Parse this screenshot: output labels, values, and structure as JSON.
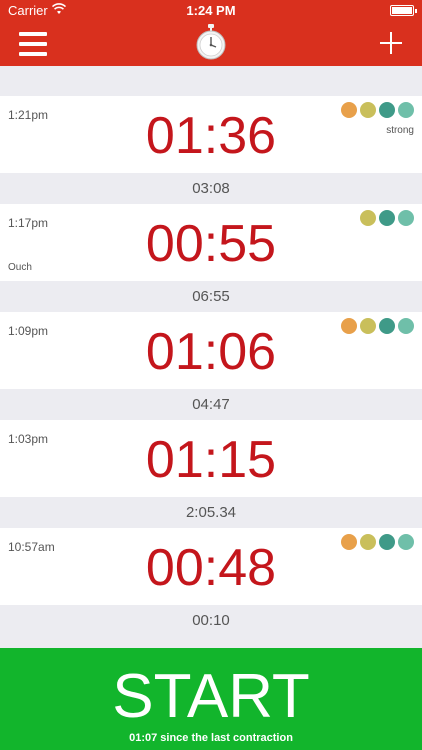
{
  "status_bar": {
    "carrier": "Carrier",
    "time": "1:24 PM"
  },
  "colors": {
    "accent": "#d9301e",
    "duration_text": "#c4161c",
    "start": "#12b52c",
    "dot_orange": "#e8a04a",
    "dot_olive": "#c9bf5b",
    "dot_teal": "#3f9a88",
    "dot_aqua": "#6fbfa9"
  },
  "navbar": {
    "menu_icon": "hamburger-menu-icon",
    "logo_icon": "stopwatch-icon",
    "add_icon": "plus-icon"
  },
  "contractions": [
    {
      "time": "1:21pm",
      "duration": "01:36",
      "note": "",
      "intensity": "strong",
      "dots": [
        "dot_orange",
        "dot_olive",
        "dot_teal",
        "dot_aqua"
      ]
    },
    {
      "interval": "03:08"
    },
    {
      "time": "1:17pm",
      "duration": "00:55",
      "note": "Ouch",
      "intensity": "",
      "dots": [
        "dot_olive",
        "dot_teal",
        "dot_aqua"
      ]
    },
    {
      "interval": "06:55"
    },
    {
      "time": "1:09pm",
      "duration": "01:06",
      "note": "",
      "intensity": "",
      "dots": [
        "dot_orange",
        "dot_olive",
        "dot_teal",
        "dot_aqua"
      ]
    },
    {
      "interval": "04:47"
    },
    {
      "time": "1:03pm",
      "duration": "01:15",
      "note": "",
      "intensity": "",
      "dots": []
    },
    {
      "interval": "2:05.34"
    },
    {
      "time": "10:57am",
      "duration": "00:48",
      "note": "",
      "intensity": "",
      "dots": [
        "dot_orange",
        "dot_olive",
        "dot_teal",
        "dot_aqua"
      ]
    },
    {
      "interval": "00:10"
    }
  ],
  "start_button": {
    "label": "START",
    "since": "01:07 since the last contraction"
  }
}
